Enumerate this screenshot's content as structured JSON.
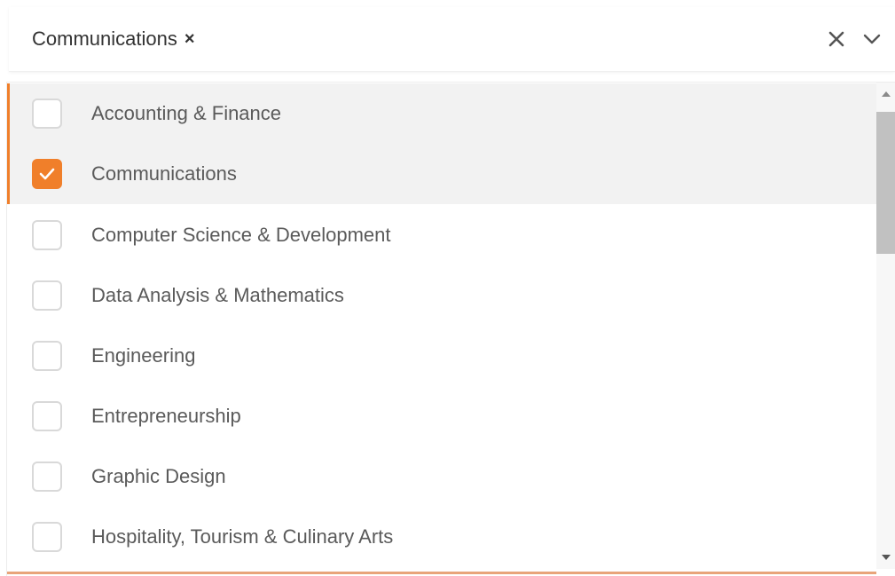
{
  "select": {
    "selected_chip": "Communications",
    "chip_remove_glyph": "×",
    "clear_icon": "x-icon",
    "toggle_icon": "chevron-down-icon"
  },
  "options": [
    {
      "label": "Accounting & Finance",
      "checked": false
    },
    {
      "label": "Communications",
      "checked": true
    },
    {
      "label": "Computer Science & Development",
      "checked": false
    },
    {
      "label": "Data Analysis & Mathematics",
      "checked": false
    },
    {
      "label": "Engineering",
      "checked": false
    },
    {
      "label": "Entrepreneurship",
      "checked": false
    },
    {
      "label": "Graphic Design",
      "checked": false
    },
    {
      "label": "Hospitality, Tourism & Culinary Arts",
      "checked": false
    }
  ],
  "colors": {
    "accent": "#f07f2a",
    "highlight_bg": "#f2f2f2",
    "label_text": "#5a5a5a"
  }
}
